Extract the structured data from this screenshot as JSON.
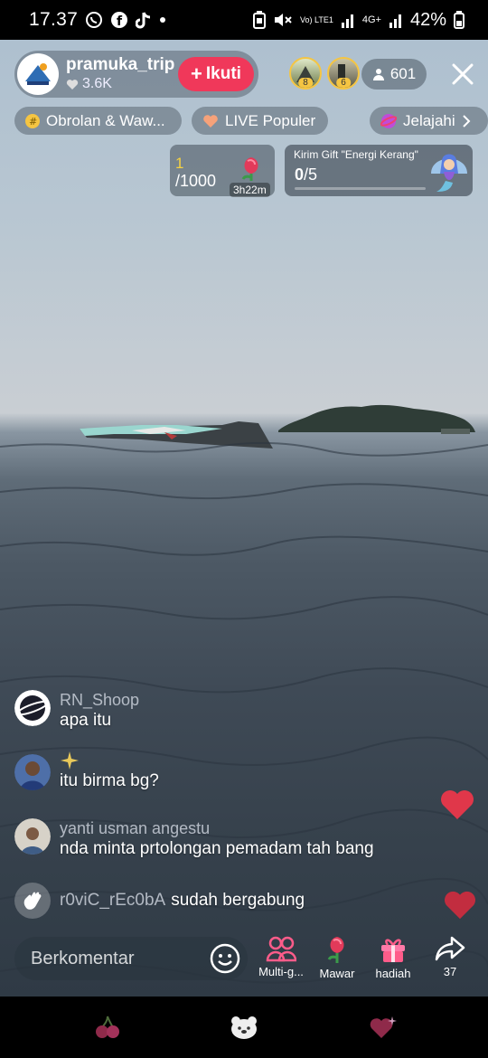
{
  "status_bar": {
    "time": "17.37",
    "signal_label": "Vo) LTE1",
    "net_label": "4G+",
    "battery": "42%",
    "icons": [
      "whatsapp-icon",
      "facebook-icon",
      "tiktok-icon",
      "dot-icon",
      "battery-saver-icon",
      "mute-icon",
      "signal-icon",
      "signal-icon",
      "battery-icon"
    ]
  },
  "host": {
    "name": "pramuka_trip",
    "likes": "3.6K",
    "follow_label": "Ikuti",
    "viewer_badges": [
      "8",
      "6"
    ],
    "viewer_count": "601"
  },
  "chips": [
    {
      "label": "Obrolan & Waw...",
      "icon": "hashtag-icon"
    },
    {
      "label": "LIVE Populer",
      "icon": "heart-icon"
    },
    {
      "label": "Jelajahi",
      "icon": "planet-icon"
    }
  ],
  "gift_goal": {
    "current": "1",
    "total": "/1000",
    "timer": "3h22m"
  },
  "mission": {
    "title": "Kirim Gift \"Energi Kerang\"",
    "progress_current": "0",
    "progress_total": "/5",
    "fraction": 0
  },
  "comments": [
    {
      "user": "RN_Shoop",
      "text": "apa itu"
    },
    {
      "user": "",
      "text": "itu birma bg?"
    },
    {
      "user": "yanti usman angestu",
      "text": "nda minta prtolongan pemadam tah bang"
    },
    {
      "user": "r0viC_rEc0bA",
      "text": "sudah bergabung"
    }
  ],
  "bottom_bar": {
    "comment_placeholder": "Berkomentar",
    "actions": [
      {
        "label": "Multi-g...",
        "icon": "multi-guest-icon"
      },
      {
        "label": "Mawar",
        "icon": "rose-icon"
      },
      {
        "label": "hadiah",
        "icon": "gift-icon"
      },
      {
        "label": "37",
        "icon": "share-icon"
      }
    ]
  },
  "colors": {
    "follow": "#f0385a",
    "gold": "#f5c542",
    "heart_red": "#e0374a"
  }
}
